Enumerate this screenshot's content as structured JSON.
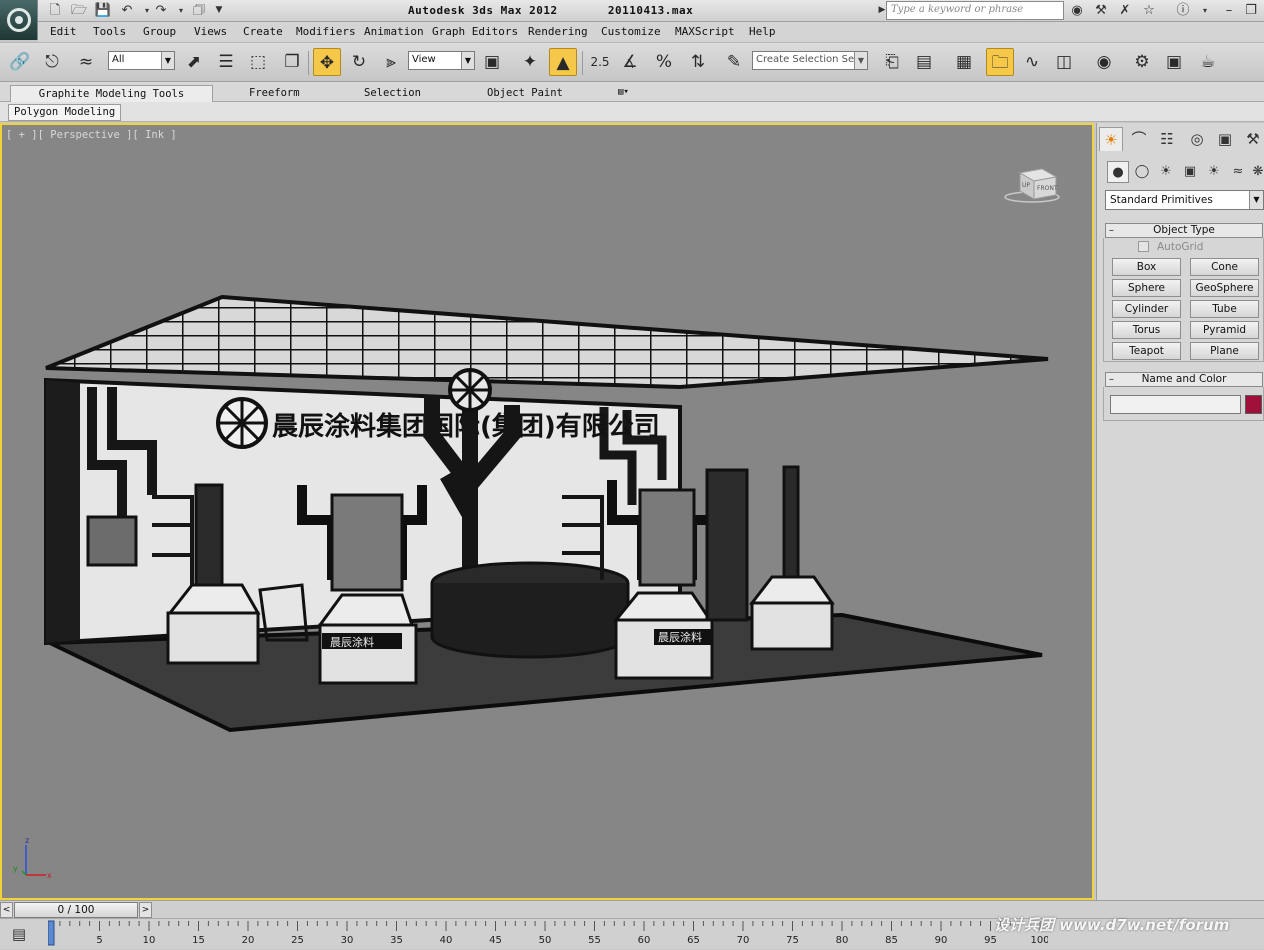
{
  "titlebar": {
    "app_title": "Autodesk 3ds Max  2012",
    "file_name": "20110413.max",
    "search_placeholder": "Type a keyword or phrase"
  },
  "menu": [
    "Edit",
    "Tools",
    "Group",
    "Views",
    "Create",
    "Modifiers",
    "Animation",
    "Graph Editors",
    "Rendering",
    "Customize",
    "MAXScript",
    "Help"
  ],
  "toolbar": {
    "selection_filter": "All",
    "ref_coord_system": "View",
    "angle_snap_label": "2.5",
    "named_selection_placeholder": "Create Selection Set"
  },
  "ribbon": {
    "tabs": [
      "Graphite Modeling Tools",
      "Freeform",
      "Selection",
      "Object Paint"
    ],
    "active_tab": "Graphite Modeling Tools",
    "panel": "Polygon Modeling"
  },
  "viewport": {
    "label": "[ + ][ Perspective ][ Ink ]",
    "viewcube_faces": [
      "UP",
      "FRONT"
    ],
    "axes": [
      "z",
      "y",
      "x"
    ],
    "booth_sign": "晨辰涂料集团国际(集团)有限公司",
    "pedestal_labels": [
      "晨辰涂料",
      "晨辰涂料"
    ]
  },
  "command_panel": {
    "category": "Standard Primitives",
    "object_type_title": "Object Type",
    "autogrid_label": "AutoGrid",
    "autogrid_checked": false,
    "primitives": [
      "Box",
      "Cone",
      "Sphere",
      "GeoSphere",
      "Cylinder",
      "Tube",
      "Torus",
      "Pyramid",
      "Teapot",
      "Plane"
    ],
    "name_color_title": "Name and Color",
    "object_name": "",
    "object_color": "#a0103a"
  },
  "timeline": {
    "frame_display": "0 / 100",
    "current_frame": 0,
    "ticks": [
      "0",
      "5",
      "10",
      "15",
      "20",
      "25",
      "30",
      "35",
      "40",
      "45",
      "50",
      "55",
      "60",
      "65",
      "70",
      "75",
      "80",
      "85",
      "90",
      "95",
      "100"
    ]
  },
  "watermark": "设计兵团  www.d7w.net/forum",
  "colors": {
    "viewport_bg": "#868686",
    "active_viewport_border": "#f0d23a",
    "active_tool": "#f6c84a"
  }
}
